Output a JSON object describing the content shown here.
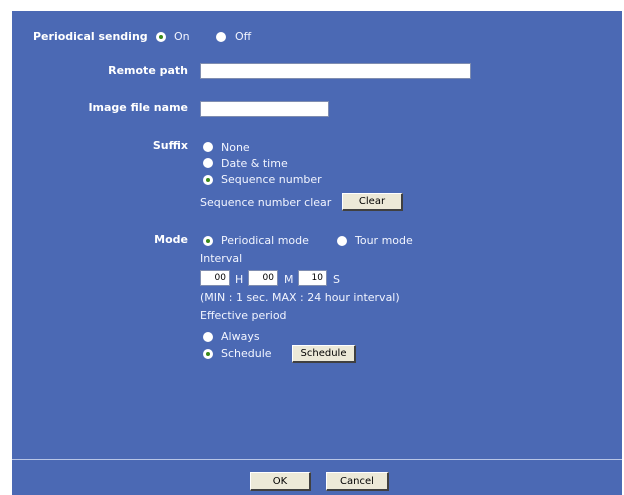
{
  "periodical_sending": {
    "label": "Periodical sending",
    "on_label": "On",
    "off_label": "Off",
    "selected": "On"
  },
  "remote_path": {
    "label": "Remote path",
    "value": ""
  },
  "image_file_name": {
    "label": "Image file name",
    "value": ""
  },
  "suffix": {
    "label": "Suffix",
    "options": [
      "None",
      "Date & time",
      "Sequence number"
    ],
    "selected": "Sequence number",
    "sequence_clear_label": "Sequence number clear",
    "clear_button": "Clear"
  },
  "mode": {
    "label": "Mode",
    "options": [
      "Periodical mode",
      "Tour mode"
    ],
    "selected": "Periodical mode",
    "interval_label": "Interval",
    "hours": "00",
    "hours_unit": "H",
    "minutes": "00",
    "minutes_unit": "M",
    "seconds": "10",
    "seconds_unit": "S",
    "interval_note": "(MIN : 1 sec. MAX : 24 hour interval)",
    "effective_period_label": "Effective period",
    "period_options": [
      "Always",
      "Schedule"
    ],
    "period_selected": "Schedule",
    "schedule_button": "Schedule"
  },
  "footer": {
    "ok_button": "OK",
    "cancel_button": "Cancel"
  },
  "colors": {
    "panel": "#4b69b4",
    "radio_checked": "#3a8a1a"
  }
}
